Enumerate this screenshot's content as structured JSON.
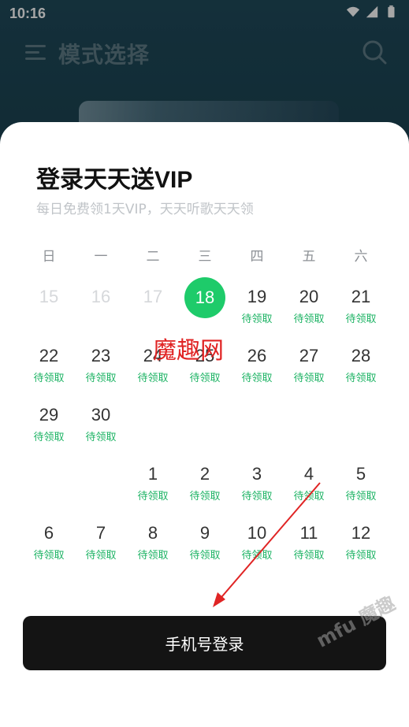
{
  "status": {
    "time": "10:16"
  },
  "app": {
    "title": "模式选择"
  },
  "sheet": {
    "title": "登录天天送VIP",
    "subtitle": "每日免费领1天VIP，天天听歌天天领",
    "weekdays": [
      "日",
      "一",
      "二",
      "三",
      "四",
      "五",
      "六"
    ],
    "tag_label": "待领取",
    "days": [
      {
        "n": "15",
        "state": "past"
      },
      {
        "n": "16",
        "state": "past"
      },
      {
        "n": "17",
        "state": "past"
      },
      {
        "n": "18",
        "state": "today"
      },
      {
        "n": "19",
        "state": "claim"
      },
      {
        "n": "20",
        "state": "claim"
      },
      {
        "n": "21",
        "state": "claim"
      },
      {
        "n": "22",
        "state": "claim"
      },
      {
        "n": "23",
        "state": "claim"
      },
      {
        "n": "24",
        "state": "claim"
      },
      {
        "n": "25",
        "state": "claim"
      },
      {
        "n": "26",
        "state": "claim"
      },
      {
        "n": "27",
        "state": "claim"
      },
      {
        "n": "28",
        "state": "claim"
      },
      {
        "n": "29",
        "state": "claim"
      },
      {
        "n": "30",
        "state": "claim"
      },
      {
        "n": "",
        "state": "empty"
      },
      {
        "n": "",
        "state": "empty"
      },
      {
        "n": "",
        "state": "empty"
      },
      {
        "n": "",
        "state": "empty"
      },
      {
        "n": "",
        "state": "empty"
      },
      {
        "n": "",
        "state": "empty"
      },
      {
        "n": "",
        "state": "empty"
      },
      {
        "n": "1",
        "state": "claim"
      },
      {
        "n": "2",
        "state": "claim"
      },
      {
        "n": "3",
        "state": "claim"
      },
      {
        "n": "4",
        "state": "claim"
      },
      {
        "n": "5",
        "state": "claim"
      },
      {
        "n": "6",
        "state": "claim"
      },
      {
        "n": "7",
        "state": "claim"
      },
      {
        "n": "8",
        "state": "claim"
      },
      {
        "n": "9",
        "state": "claim"
      },
      {
        "n": "10",
        "state": "claim"
      },
      {
        "n": "11",
        "state": "claim"
      },
      {
        "n": "12",
        "state": "claim"
      }
    ],
    "login_button": "手机号登录"
  },
  "watermark": {
    "red": "魔趣网",
    "diagonal": "mfu 魔趣"
  },
  "colors": {
    "accent_green": "#1ecb6a",
    "tag_green": "#1db364",
    "button_dark": "#141414"
  }
}
